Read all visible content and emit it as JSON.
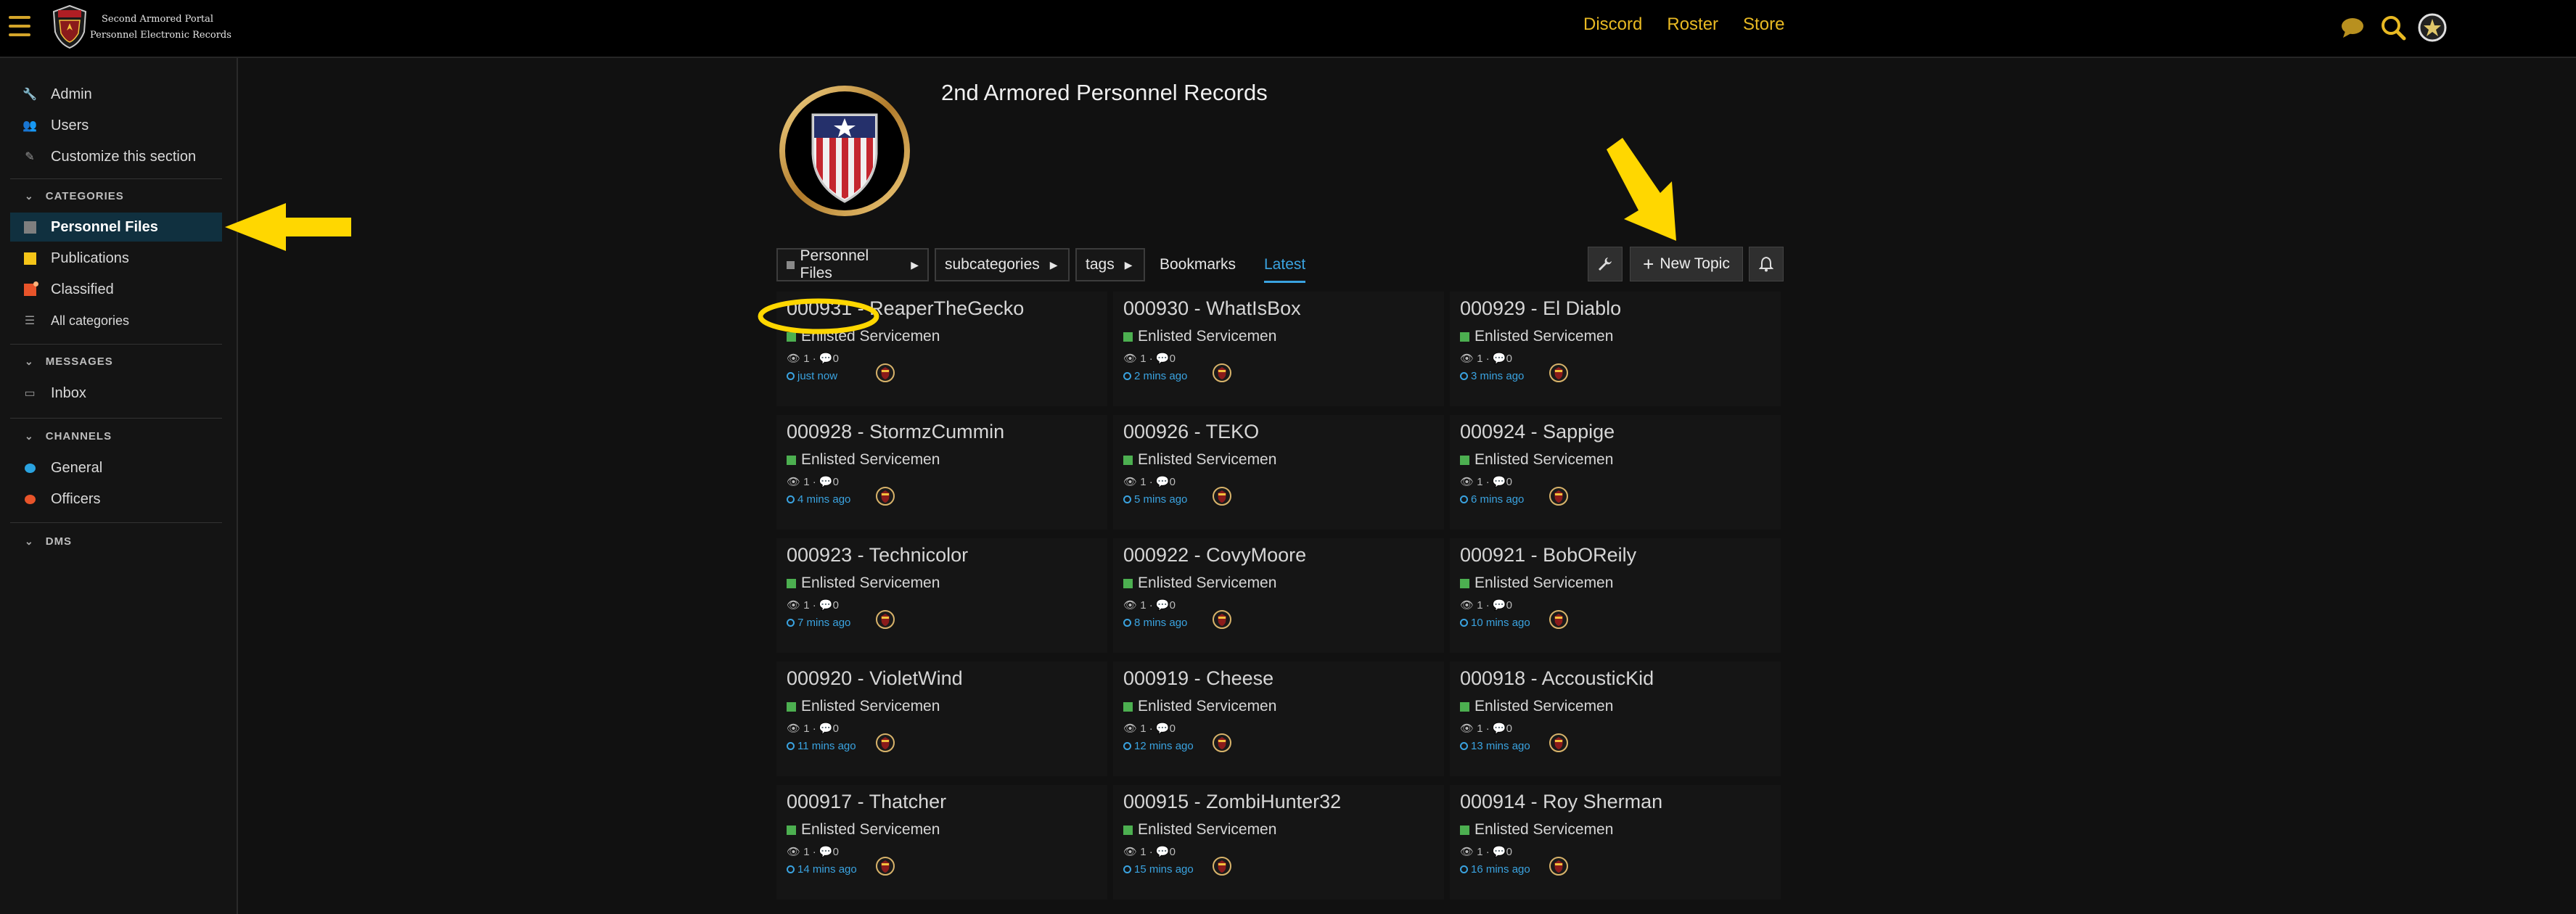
{
  "header": {
    "site_title_line1": "Second Armored Portal",
    "site_title_line2": "Personnel Electronic Records",
    "links": [
      "Discord",
      "Roster",
      "Store"
    ],
    "icons": [
      "chat-icon",
      "search-icon",
      "user-avatar"
    ]
  },
  "sidebar": {
    "top_items": [
      {
        "label": "Admin",
        "icon": "wrench-icon"
      },
      {
        "label": "Users",
        "icon": "users-icon"
      },
      {
        "label": "Customize this section",
        "icon": "pencil-icon"
      }
    ],
    "categories_heading": "CATEGORIES",
    "categories": [
      {
        "label": "Personnel Files",
        "color": "#7f7f7f",
        "active": true
      },
      {
        "label": "Publications",
        "color": "#f5c518"
      },
      {
        "label": "Classified",
        "color": "#e8542a"
      },
      {
        "label": "All categories",
        "icon": "list-icon"
      }
    ],
    "messages_heading": "MESSAGES",
    "messages": [
      {
        "label": "Inbox",
        "icon": "inbox-icon"
      }
    ],
    "channels_heading": "CHANNELS",
    "channels": [
      {
        "label": "General",
        "icon": "chat-bubble-icon",
        "color": "#2aa3e0"
      },
      {
        "label": "Officers",
        "icon": "chat-bubble-icon",
        "color": "#e8542a"
      }
    ],
    "dms_heading": "DMS"
  },
  "category": {
    "title": "2nd Armored Personnel Records"
  },
  "nav": {
    "category_dropdown": "Personnel Files",
    "subcategories_dropdown": "subcategories",
    "tags_dropdown": "tags",
    "bookmarks": "Bookmarks",
    "latest": "Latest",
    "new_topic": "New Topic"
  },
  "topics": [
    {
      "title": "000931 - ReaperTheGecko",
      "category": "Enlisted Servicemen",
      "views": "1",
      "replies": "0",
      "time": "just now"
    },
    {
      "title": "000930 - WhatIsBox",
      "category": "Enlisted Servicemen",
      "views": "1",
      "replies": "0",
      "time": "2 mins ago"
    },
    {
      "title": "000929 - El Diablo",
      "category": "Enlisted Servicemen",
      "views": "1",
      "replies": "0",
      "time": "3 mins ago"
    },
    {
      "title": "000928 - StormzCummin",
      "category": "Enlisted Servicemen",
      "views": "1",
      "replies": "0",
      "time": "4 mins ago"
    },
    {
      "title": "000926 - TEKO",
      "category": "Enlisted Servicemen",
      "views": "1",
      "replies": "0",
      "time": "5 mins ago"
    },
    {
      "title": "000924 - Sappige",
      "category": "Enlisted Servicemen",
      "views": "1",
      "replies": "0",
      "time": "6 mins ago"
    },
    {
      "title": "000923 - Technicolor",
      "category": "Enlisted Servicemen",
      "views": "1",
      "replies": "0",
      "time": "7 mins ago"
    },
    {
      "title": "000922 - CovyMoore",
      "category": "Enlisted Servicemen",
      "views": "1",
      "replies": "0",
      "time": "8 mins ago"
    },
    {
      "title": "000921 - BobOReily",
      "category": "Enlisted Servicemen",
      "views": "1",
      "replies": "0",
      "time": "10 mins ago"
    },
    {
      "title": "000920 - VioletWind",
      "category": "Enlisted Servicemen",
      "views": "1",
      "replies": "0",
      "time": "11 mins ago"
    },
    {
      "title": "000919 - Cheese",
      "category": "Enlisted Servicemen",
      "views": "1",
      "replies": "0",
      "time": "12 mins ago"
    },
    {
      "title": "000918 - AccousticKid",
      "category": "Enlisted Servicemen",
      "views": "1",
      "replies": "0",
      "time": "13 mins ago"
    },
    {
      "title": "000917 - Thatcher",
      "category": "Enlisted Servicemen",
      "views": "1",
      "replies": "0",
      "time": "14 mins ago"
    },
    {
      "title": "000915 - ZombiHunter32",
      "category": "Enlisted Servicemen",
      "views": "1",
      "replies": "0",
      "time": "15 mins ago"
    },
    {
      "title": "000914 - Roy Sherman",
      "category": "Enlisted Servicemen",
      "views": "1",
      "replies": "0",
      "time": "16 mins ago"
    }
  ],
  "colors": {
    "accent_gold": "#e8b923",
    "link_blue": "#3aa3e0",
    "category_green": "#4caf50",
    "annotation_yellow": "#ffd700"
  }
}
